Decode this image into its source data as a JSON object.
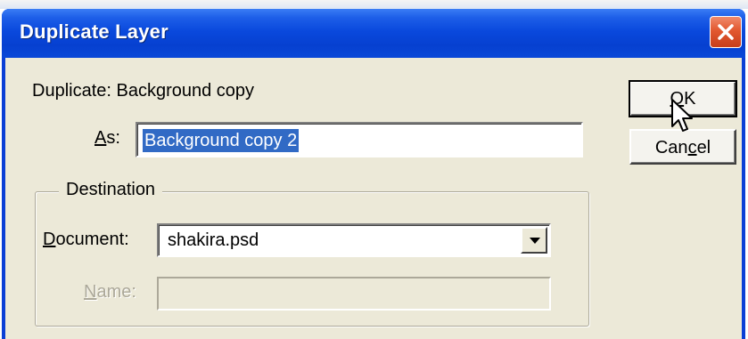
{
  "dialog": {
    "title": "Duplicate Layer",
    "source_prefix": "Duplicate:",
    "source_layer": "Background copy",
    "as_label_hotkey": "A",
    "as_label_rest": "s:",
    "as_value": "Background copy 2"
  },
  "buttons": {
    "ok_hotkey": "O",
    "ok_rest": "K",
    "cancel_pre": "Can",
    "cancel_hotkey": "c",
    "cancel_rest": "el"
  },
  "destination": {
    "legend": "Destination",
    "document_label_hotkey": "D",
    "document_label_rest": "ocument:",
    "document_value": "shakira.psd",
    "name_label_hotkey": "N",
    "name_label_rest": "ame:",
    "name_value": "",
    "name_enabled": false
  },
  "icons": {
    "close": "close-icon",
    "dropdown": "chevron-down-icon",
    "cursor": "mouse-pointer-icon"
  },
  "colors": {
    "titlebar": "#0a49dd",
    "dialog_bg": "#ece9d8",
    "close_button": "#e2582f",
    "selection": "#316ac5"
  }
}
